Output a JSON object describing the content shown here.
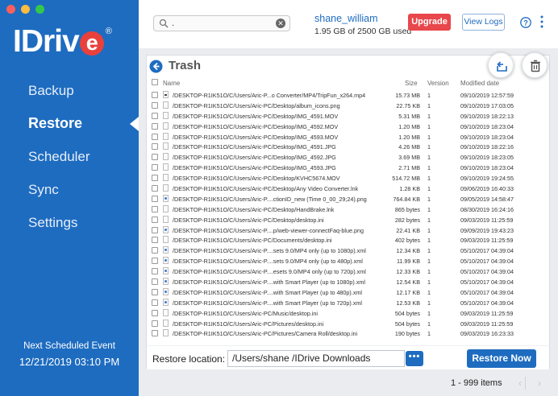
{
  "sidebar": {
    "logo_text": "IDrive",
    "nav": [
      "Backup",
      "Restore",
      "Scheduler",
      "Sync",
      "Settings"
    ],
    "active_nav": "Restore",
    "next_scheduled_title": "Next Scheduled Event",
    "next_scheduled_time": "12/21/2019 03:10 PM",
    "color": "#1e6cc0"
  },
  "header": {
    "search_value": ".",
    "user_name": "shane_william",
    "usage": "1.95 GB of 2500 GB used",
    "upgrade_label": "Upgrade",
    "view_logs_label": "View Logs",
    "help_icon": "help-icon",
    "more_icon": "more-vertical-icon"
  },
  "trash": {
    "title": "Trash",
    "columns": {
      "name": "Name",
      "size": "Size",
      "version": "Version",
      "modified": "Modified date"
    },
    "rows": [
      {
        "path": "/DESKTOP-R1IK51O/C/Users/Aric-P...o Converter/MP4/TripFun_x264.mp4",
        "size": "15.73 MB",
        "version": "1",
        "modified": "09/10/2019 12:57:59",
        "icon": "dark"
      },
      {
        "path": "/DESKTOP-R1IK51O/C/Users/Aric-PC/Desktop/album_icons.png",
        "size": "22.75 KB",
        "version": "1",
        "modified": "09/10/2019 17:03:05",
        "icon": "plain"
      },
      {
        "path": "/DESKTOP-R1IK51O/C/Users/Aric-PC/Desktop/IMG_4591.MOV",
        "size": "5.31 MB",
        "version": "1",
        "modified": "09/10/2019 18:22:13",
        "icon": "plain"
      },
      {
        "path": "/DESKTOP-R1IK51O/C/Users/Aric-PC/Desktop/IMG_4592.MOV",
        "size": "1.20 MB",
        "version": "1",
        "modified": "09/10/2019 18:23:04",
        "icon": "plain"
      },
      {
        "path": "/DESKTOP-R1IK51O/C/Users/Aric-PC/Desktop/IMG_4593.MOV",
        "size": "1.20 MB",
        "version": "1",
        "modified": "09/10/2019 18:23:04",
        "icon": "plain"
      },
      {
        "path": "/DESKTOP-R1IK51O/C/Users/Aric-PC/Desktop/IMG_4591.JPG",
        "size": "4.26 MB",
        "version": "1",
        "modified": "09/10/2019 18:22:16",
        "icon": "plain"
      },
      {
        "path": "/DESKTOP-R1IK51O/C/Users/Aric-PC/Desktop/IMG_4592.JPG",
        "size": "3.69 MB",
        "version": "1",
        "modified": "09/10/2019 18:23:05",
        "icon": "plain"
      },
      {
        "path": "/DESKTOP-R1IK51O/C/Users/Aric-PC/Desktop/IMG_4593.JPG",
        "size": "2.71 MB",
        "version": "1",
        "modified": "09/10/2019 18:23:04",
        "icon": "plain"
      },
      {
        "path": "/DESKTOP-R1IK51O/C/Users/Aric-PC/Desktop/KVHC5674.MOV",
        "size": "514.72 MB",
        "version": "1",
        "modified": "09/10/2019 19:24:55",
        "icon": "plain"
      },
      {
        "path": "/DESKTOP-R1IK51O/C/Users/Aric-PC/Desktop/Any Video Converter.lnk",
        "size": "1.28 KB",
        "version": "1",
        "modified": "09/06/2019 16:40:33",
        "icon": "plain"
      },
      {
        "path": "/DESKTOP-R1IK51O/C/Users/Aric-P....ctionID_new (Time 0_00_29;24).png",
        "size": "764.84 KB",
        "version": "1",
        "modified": "09/05/2019 14:58:47",
        "icon": "blue"
      },
      {
        "path": "/DESKTOP-R1IK51O/C/Users/Aric-PC/Desktop/HandBrake.lnk",
        "size": "865 bytes",
        "version": "1",
        "modified": "08/30/2019 16:24:16",
        "icon": "plain"
      },
      {
        "path": "/DESKTOP-R1IK51O/C/Users/Aric-PC/Desktop/desktop.ini",
        "size": "282 bytes",
        "version": "1",
        "modified": "09/03/2019 11:25:59",
        "icon": "plain"
      },
      {
        "path": "/DESKTOP-R1IK51O/C/Users/Aric-P....p/web-viewer-connectFaq-blue.png",
        "size": "22.41 KB",
        "version": "1",
        "modified": "09/09/2019 19:43:23",
        "icon": "blue"
      },
      {
        "path": "/DESKTOP-R1IK51O/C/Users/Aric-PC/Documents/desktop.ini",
        "size": "402 bytes",
        "version": "1",
        "modified": "09/03/2019 11:25:59",
        "icon": "plain"
      },
      {
        "path": "/DESKTOP-R1IK51O/C/Users/Aric-P....sets 9.0/MP4 only (up to 1080p).xml",
        "size": "12.34 KB",
        "version": "1",
        "modified": "05/10/2017 04:39:04",
        "icon": "blue"
      },
      {
        "path": "/DESKTOP-R1IK51O/C/Users/Aric-P....sets 9.0/MP4 only (up to 480p).xml",
        "size": "11.99 KB",
        "version": "1",
        "modified": "05/10/2017 04:39:04",
        "icon": "blue"
      },
      {
        "path": "/DESKTOP-R1IK51O/C/Users/Aric-P....esets 9.0/MP4 only (up to 720p).xml",
        "size": "12.33 KB",
        "version": "1",
        "modified": "05/10/2017 04:39:04",
        "icon": "blue"
      },
      {
        "path": "/DESKTOP-R1IK51O/C/Users/Aric-P....with Smart Player (up to 1080p).xml",
        "size": "12.54 KB",
        "version": "1",
        "modified": "05/10/2017 04:39:04",
        "icon": "blue"
      },
      {
        "path": "/DESKTOP-R1IK51O/C/Users/Aric-P....with Smart Player (up to 480p).xml",
        "size": "12.17 KB",
        "version": "1",
        "modified": "05/10/2017 04:39:04",
        "icon": "blue"
      },
      {
        "path": "/DESKTOP-R1IK51O/C/Users/Aric-P....with Smart Player (up to 720p).xml",
        "size": "12.53 KB",
        "version": "1",
        "modified": "05/10/2017 04:39:04",
        "icon": "blue"
      },
      {
        "path": "/DESKTOP-R1IK51O/C/Users/Aric-PC/Music/desktop.ini",
        "size": "504 bytes",
        "version": "1",
        "modified": "09/03/2019 11:25:59",
        "icon": "plain"
      },
      {
        "path": "/DESKTOP-R1IK51O/C/Users/Aric-PC/Pictures/desktop.ini",
        "size": "504 bytes",
        "version": "1",
        "modified": "09/03/2019 11:25:59",
        "icon": "plain"
      },
      {
        "path": "/DESKTOP-R1IK51O/C/Users/Aric-PC/Pictures/Camera Roll/desktop.ini",
        "size": "190 bytes",
        "version": "1",
        "modified": "09/03/2019 16:23:33",
        "icon": "plain"
      }
    ],
    "restore_location_label": "Restore location:",
    "restore_location_value": "/Users/shane /IDrive Downloads",
    "browse_label": "•••",
    "restore_now_label": "Restore Now",
    "item_count": "1 - 999 items"
  }
}
